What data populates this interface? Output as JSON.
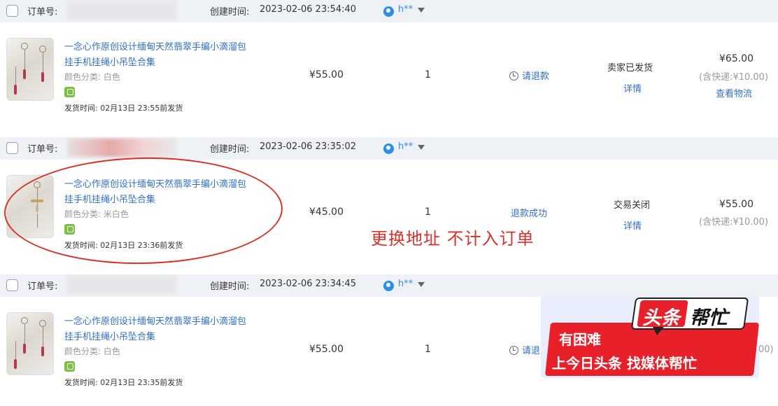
{
  "labels": {
    "order_no": "订单号:",
    "created": "创建时间:",
    "spec_prefix": "颜色分类:",
    "detail": "详情"
  },
  "orders": [
    {
      "create_time": "2023-02-06 23:54:40",
      "buyer": "h**",
      "title_line1": "一念心作原创设计缅甸天然翡翠手编小滴溜包",
      "title_line2": "挂手机挂绳小吊坠合集",
      "spec_value": "白色",
      "ship_time": "发货时间: 02月13日 23:55前发货",
      "price": "¥55.00",
      "qty": "1",
      "refund": "请退款",
      "status": "卖家已发货",
      "total": "¥65.00",
      "shipfee": "(含快递:¥10.00)",
      "logistics": "查看物流"
    },
    {
      "create_time": "2023-02-06 23:35:02",
      "buyer": "h**",
      "title_line1": "一念心作原创设计缅甸天然翡翠手编小滴溜包",
      "title_line2": "挂手机挂绳小吊坠合集",
      "spec_value": "米白色",
      "ship_time": "发货时间: 02月13日 23:36前发货",
      "price": "¥45.00",
      "qty": "1",
      "refund": "退款成功",
      "status": "交易关闭",
      "total": "¥55.00",
      "shipfee": "(含快递:¥10.00)"
    },
    {
      "create_time": "2023-02-06 23:34:45",
      "buyer": "h**",
      "title_line1": "一念心作原创设计缅甸天然翡翠手编小滴溜包",
      "title_line2": "挂手机挂绳小吊坠合集",
      "spec_value": "白色",
      "ship_time": "发货时间: 02月13日 23:35前发货",
      "price": "¥55.00",
      "qty": "1",
      "refund": "请退",
      "shipfee_partial": "00)"
    }
  ],
  "annotation": {
    "text": "更换地址 不计入订单",
    "color": "#d9302a"
  },
  "promo": {
    "logo_a": "头条",
    "logo_b": "帮忙",
    "line1": "有困难",
    "line2": "上今日头条 找媒体帮忙",
    "brand_color": "#e8202a"
  },
  "colors": {
    "link": "#2f6fc4",
    "header_bg": "#eef1f6"
  }
}
